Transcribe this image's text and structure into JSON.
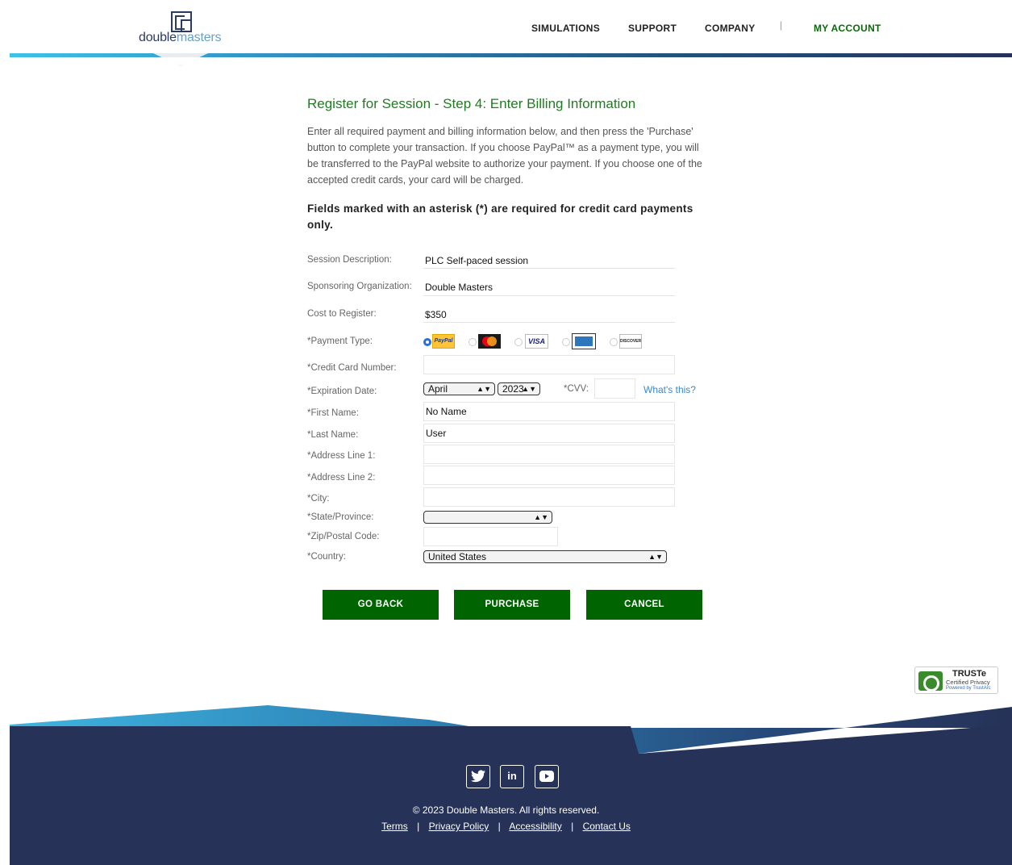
{
  "header": {
    "logo_prefix": "double",
    "logo_suffix": "masters",
    "nav": [
      "SIMULATIONS",
      "SUPPORT",
      "COMPANY",
      "MY ACCOUNT"
    ],
    "nav_separator": "|",
    "colors": {
      "nav_active": "#0a6a0a",
      "brand_navy": "#2b3a5e"
    }
  },
  "main": {
    "title": "Register for Session - Step 4: Enter Billing Information",
    "intro": "Enter all required payment and billing information below, and then press the 'Purchase' button to complete your transaction. If you choose PayPal™ as a payment type, you will be transferred to the PayPal website to authorize your payment. If you choose one of the accepted credit cards, your card will be charged.",
    "required_note": "Fields marked with an asterisk (*) are required for credit card payments only."
  },
  "form": {
    "session_description": {
      "label": "Session Description:",
      "value": "PLC Self-paced session"
    },
    "sponsoring_org": {
      "label": "Sponsoring Organization:",
      "value": "Double Masters"
    },
    "cost": {
      "label": "Cost to Register:",
      "value": "$350"
    },
    "payment_type": {
      "label": "*Payment Type:",
      "options": [
        {
          "name": "PayPal",
          "text": "PayPal",
          "selected": true
        },
        {
          "name": "MasterCard",
          "text": "MasterCard",
          "selected": false
        },
        {
          "name": "Visa",
          "text": "VISA",
          "selected": false
        },
        {
          "name": "American Express",
          "text": "AMEX",
          "selected": false
        },
        {
          "name": "Discover",
          "text": "DISCOVER",
          "selected": false
        }
      ]
    },
    "card_number": {
      "label": "*Credit Card Number:",
      "value": ""
    },
    "expiration": {
      "label": "*Expiration Date:",
      "month": "April",
      "year": "2023"
    },
    "cvv": {
      "label": "*CVV:",
      "value": "",
      "help": "What's this?"
    },
    "first_name": {
      "label": "*First Name:",
      "value": "No Name"
    },
    "last_name": {
      "label": "*Last Name:",
      "value": "User"
    },
    "address1": {
      "label": "*Address Line 1:",
      "value": ""
    },
    "address2": {
      "label": "*Address Line 2:",
      "value": ""
    },
    "city": {
      "label": "*City:",
      "value": ""
    },
    "state": {
      "label": "*State/Province:",
      "value": ""
    },
    "zip": {
      "label": "*Zip/Postal Code:",
      "value": ""
    },
    "country": {
      "label": "*Country:",
      "value": "United States"
    }
  },
  "buttons": {
    "go_back": "GO BACK",
    "purchase": "PURCHASE",
    "cancel": "CANCEL"
  },
  "truste": {
    "title": "TRUSTe",
    "subtitle": "Certified Privacy",
    "powered": "Powered by TrustArc"
  },
  "footer": {
    "social": [
      "twitter",
      "linkedin",
      "youtube"
    ],
    "copyright": "© 2023 Double Masters. All rights reserved.",
    "links": [
      "Terms",
      "Privacy Policy",
      "Accessibility",
      "Contact Us"
    ],
    "link_separator": "|",
    "colors": {
      "footer_bg": "#263257",
      "wave_light": "#3fb4de"
    }
  }
}
